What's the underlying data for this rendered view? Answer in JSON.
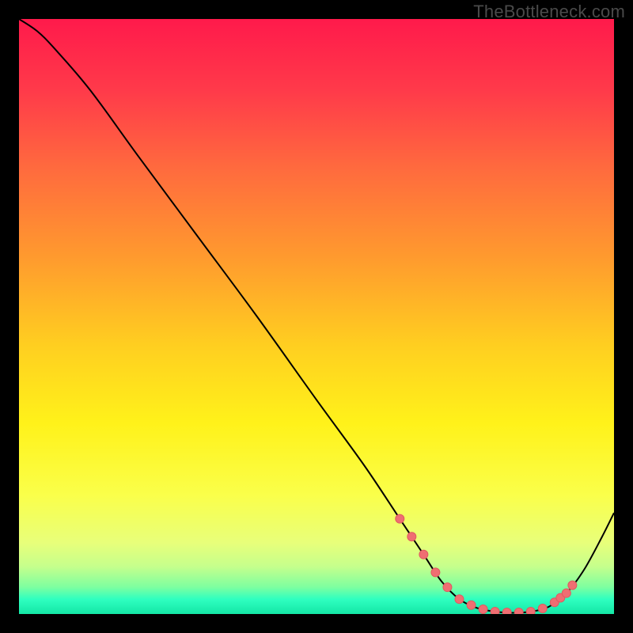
{
  "watermark": "TheBottleneck.com",
  "colors": {
    "bg": "#000000",
    "watermark_color": "#4a4a4a",
    "curve": "#000000",
    "markers_fill": "#ef6e72",
    "markers_stroke": "#e05a60",
    "gradient_stops": [
      {
        "offset": 0.0,
        "color": "#ff1a4b"
      },
      {
        "offset": 0.12,
        "color": "#ff3a4a"
      },
      {
        "offset": 0.25,
        "color": "#ff6a3e"
      },
      {
        "offset": 0.4,
        "color": "#ff9a2e"
      },
      {
        "offset": 0.55,
        "color": "#ffcf20"
      },
      {
        "offset": 0.68,
        "color": "#fff21a"
      },
      {
        "offset": 0.8,
        "color": "#faff4a"
      },
      {
        "offset": 0.88,
        "color": "#e8ff7a"
      },
      {
        "offset": 0.92,
        "color": "#c6ff8c"
      },
      {
        "offset": 0.955,
        "color": "#7dffa0"
      },
      {
        "offset": 0.975,
        "color": "#2fffc0"
      },
      {
        "offset": 1.0,
        "color": "#14e7a6"
      }
    ]
  },
  "chart_data": {
    "type": "line",
    "title": "",
    "xlabel": "",
    "ylabel": "",
    "xlim": [
      0,
      100
    ],
    "ylim": [
      0,
      100
    ],
    "grid": false,
    "series": [
      {
        "name": "bottleneck-curve",
        "x": [
          0,
          3,
          6,
          12,
          20,
          30,
          40,
          50,
          58,
          64,
          68,
          71,
          74,
          77,
          80,
          83,
          86,
          89,
          92,
          95,
          98,
          100
        ],
        "y": [
          100,
          98,
          95,
          88,
          77,
          63.5,
          50,
          36,
          25,
          16,
          10,
          5.5,
          2.5,
          1.0,
          0.4,
          0.2,
          0.4,
          1.2,
          3.5,
          7.5,
          13,
          17
        ],
        "markers_at_x": [
          64,
          66,
          68,
          70,
          72,
          74,
          76,
          78,
          80,
          82,
          84,
          86,
          88,
          90,
          91,
          92,
          93
        ]
      }
    ]
  }
}
